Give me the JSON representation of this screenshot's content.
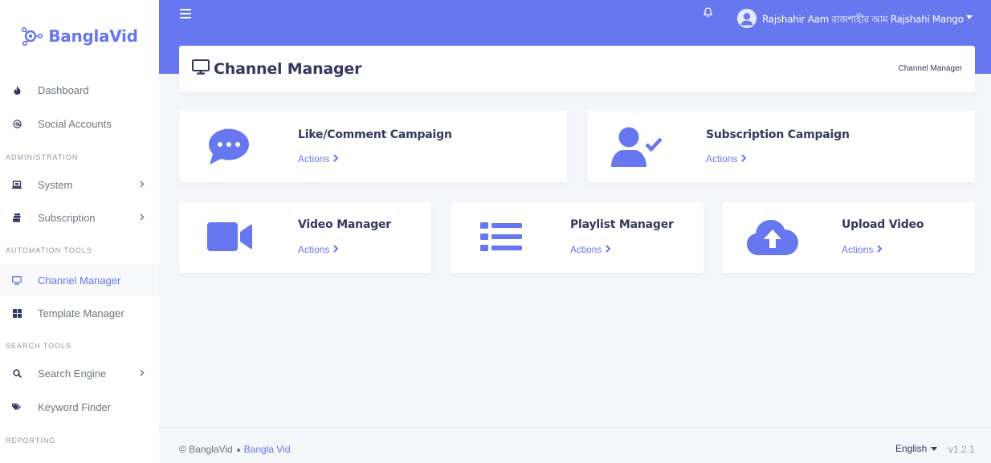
{
  "brand": {
    "name_part1": "Bangla",
    "name_part2": "Vid"
  },
  "sidebar": {
    "items": [
      {
        "label": "Dashboard",
        "icon": "fire-icon"
      },
      {
        "label": "Social Accounts",
        "icon": "at-sign-icon"
      },
      {
        "label": "System",
        "icon": "laptop-icon"
      },
      {
        "label": "Subscription",
        "icon": "cards-icon"
      },
      {
        "label": "Channel Manager",
        "icon": "desktop-icon"
      },
      {
        "label": "Template Manager",
        "icon": "grid-icon"
      },
      {
        "label": "Search Engine",
        "icon": "search-icon"
      },
      {
        "label": "Keyword Finder",
        "icon": "tags-icon"
      }
    ],
    "headers": {
      "administration": "ADMINISTRATION",
      "automation": "AUTOMATION TOOLS",
      "search": "SEARCH TOOLS",
      "reporting": "REPORTING"
    }
  },
  "topbar": {
    "user_name": "Rajshahir Aam রাজশাহীর আম Rajshahi Mango"
  },
  "section": {
    "title": "Channel Manager",
    "breadcrumb": "Channel Manager"
  },
  "cards": [
    {
      "title": "Like/Comment Campaign",
      "link": "Actions",
      "icon": "comment-dots-icon"
    },
    {
      "title": "Subscription Campaign",
      "link": "Actions",
      "icon": "user-check-icon"
    },
    {
      "title": "Video Manager",
      "link": "Actions",
      "icon": "video-camera-icon"
    },
    {
      "title": "Playlist Manager",
      "link": "Actions",
      "icon": "list-icon"
    },
    {
      "title": "Upload Video",
      "link": "Actions",
      "icon": "cloud-upload-icon"
    }
  ],
  "footer": {
    "copyright": "© BanglaVid",
    "link": "Bangla Vid",
    "language": "English",
    "version": "v1.2.1"
  },
  "colors": {
    "primary": "#6777ef",
    "text": "#34395e",
    "muted": "#6c757d",
    "background": "#f4f6f9"
  }
}
